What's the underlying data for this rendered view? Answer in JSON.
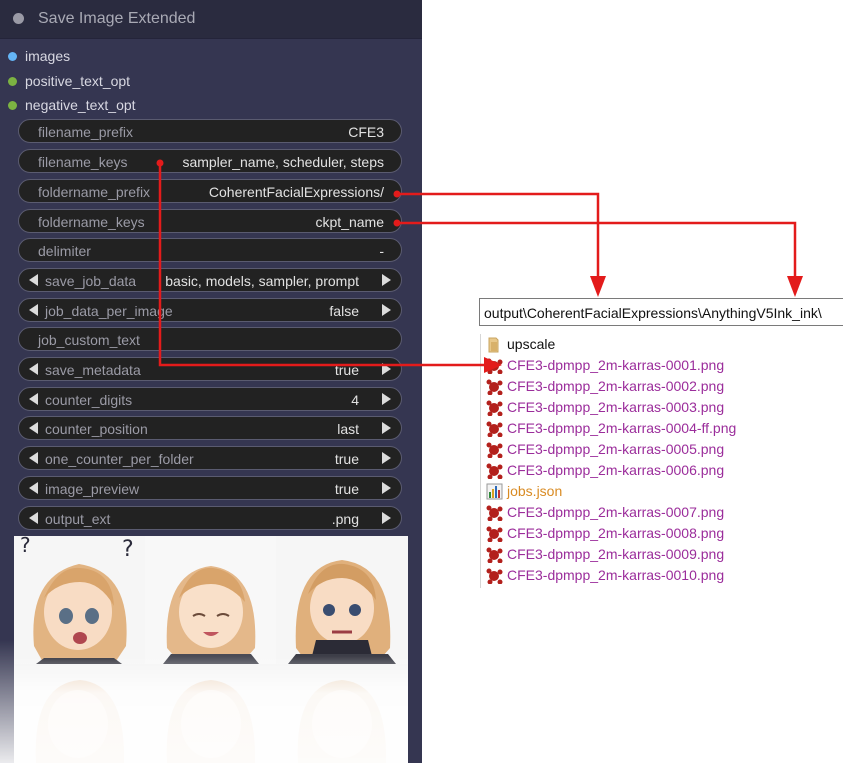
{
  "node": {
    "title": "Save Image Extended",
    "inputs": [
      {
        "label": "images",
        "color": "#64b5f6"
      },
      {
        "label": "positive_text_opt",
        "color": "#7cb342"
      },
      {
        "label": "negative_text_opt",
        "color": "#7cb342"
      }
    ],
    "widgets": [
      {
        "label": "filename_prefix",
        "value": "CFE3"
      },
      {
        "label": "filename_keys",
        "value": "sampler_name, scheduler, steps"
      },
      {
        "label": "foldername_prefix",
        "value": "CoherentFacialExpressions/"
      },
      {
        "label": "foldername_keys",
        "value": "ckpt_name"
      },
      {
        "label": "delimiter",
        "value": "-"
      },
      {
        "label": "save_job_data",
        "value": "basic, models, sampler, prompt"
      },
      {
        "label": "job_data_per_image",
        "value": "false"
      },
      {
        "label": "job_custom_text",
        "value": ""
      },
      {
        "label": "save_metadata",
        "value": "true"
      },
      {
        "label": "counter_digits",
        "value": "4"
      },
      {
        "label": "counter_position",
        "value": "last"
      },
      {
        "label": "one_counter_per_folder",
        "value": "true"
      },
      {
        "label": "image_preview",
        "value": "true"
      },
      {
        "label": "output_ext",
        "value": ".png"
      }
    ]
  },
  "explorer": {
    "path": "output\\CoherentFacialExpressions\\AnythingV5Ink_ink\\",
    "files": [
      {
        "name": "upscale",
        "type": "folder"
      },
      {
        "name": "CFE3-dpmpp_2m-karras-0001.png",
        "type": "png"
      },
      {
        "name": "CFE3-dpmpp_2m-karras-0002.png",
        "type": "png"
      },
      {
        "name": "CFE3-dpmpp_2m-karras-0003.png",
        "type": "png"
      },
      {
        "name": "CFE3-dpmpp_2m-karras-0004-ff.png",
        "type": "png"
      },
      {
        "name": "CFE3-dpmpp_2m-karras-0005.png",
        "type": "png"
      },
      {
        "name": "CFE3-dpmpp_2m-karras-0006.png",
        "type": "png"
      },
      {
        "name": "jobs.json",
        "type": "json"
      },
      {
        "name": "CFE3-dpmpp_2m-karras-0007.png",
        "type": "png"
      },
      {
        "name": "CFE3-dpmpp_2m-karras-0008.png",
        "type": "png"
      },
      {
        "name": "CFE3-dpmpp_2m-karras-0009.png",
        "type": "png"
      },
      {
        "name": "CFE3-dpmpp_2m-karras-0010.png",
        "type": "png"
      }
    ]
  },
  "colors": {
    "accent_arrow": "#e31b1b",
    "png_file": "#9b2d9b",
    "json_file": "#d98b23"
  }
}
